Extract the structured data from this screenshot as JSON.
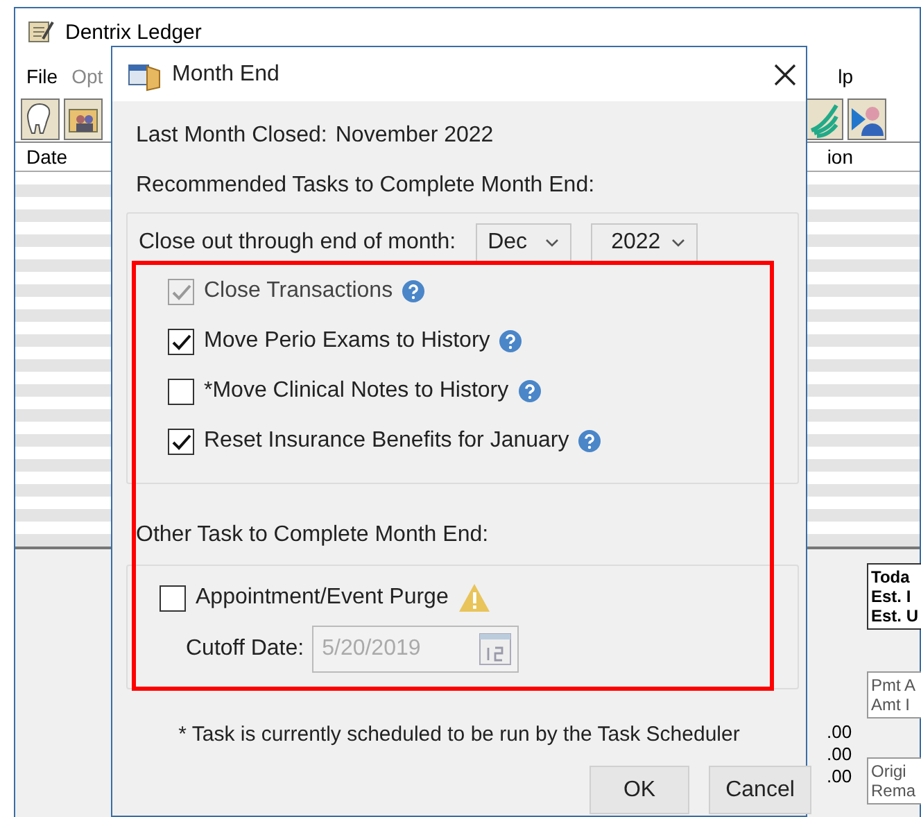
{
  "ledger": {
    "title": "Dentrix Ledger",
    "menu": [
      "File",
      "Opt",
      "lp"
    ],
    "columns": [
      "Date",
      "ion"
    ],
    "summary_1": [
      "Toda",
      "Est. I",
      "Est. U"
    ],
    "summary_2": [
      "Pmt A",
      "Amt I"
    ],
    "amounts": [
      ".00",
      ".00",
      ".00"
    ],
    "summary_3": [
      "Origi",
      "Rema"
    ]
  },
  "dialog": {
    "title": "Month End",
    "last_closed_label": "Last Month Closed:",
    "last_closed_value": "November 2022",
    "recommended_heading": "Recommended Tasks to Complete Month End:",
    "close_out_label": "Close out through end of month:",
    "month": "Dec",
    "year": "2022",
    "tasks": [
      {
        "label": "Close Transactions",
        "checked": true,
        "disabled": true
      },
      {
        "label": "Move Perio Exams to History",
        "checked": true,
        "disabled": false
      },
      {
        "label": "*Move Clinical Notes to History",
        "checked": false,
        "disabled": false
      },
      {
        "label": "Reset Insurance Benefits for January",
        "checked": true,
        "disabled": false
      }
    ],
    "other_heading": "Other Task to Complete Month End:",
    "other_tasks": [
      {
        "label": "Appointment/Event Purge",
        "checked": false
      }
    ],
    "cutoff_label": "Cutoff Date:",
    "cutoff_date": {
      "value": "5/20/2019",
      "disabled": true
    },
    "footnote": "* Task is currently scheduled to be run by the Task Scheduler",
    "buttons": [
      "OK",
      "Cancel"
    ]
  }
}
